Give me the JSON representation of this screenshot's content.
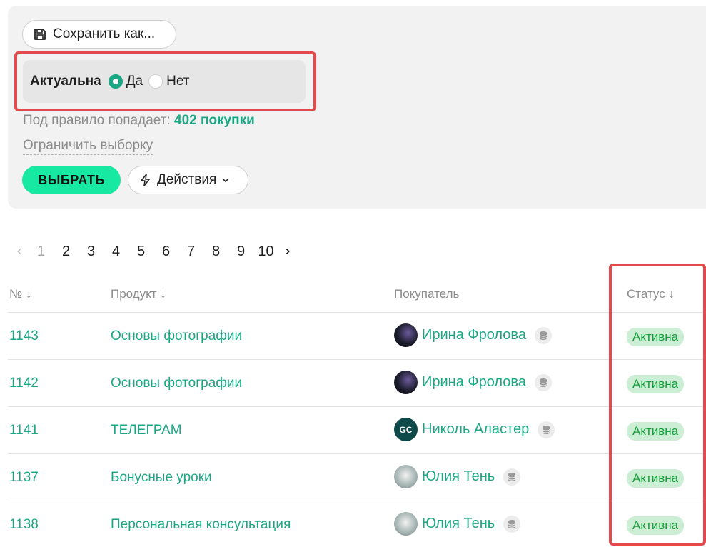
{
  "toolbar": {
    "save_as_label": "Сохранить как..."
  },
  "filter": {
    "title": "Актуальна",
    "options": [
      {
        "label": "Да",
        "checked": true
      },
      {
        "label": "Нет",
        "checked": false
      }
    ],
    "rule_text": "Под правило попадает:",
    "rule_count": "402 покупки",
    "limit_link": "Ограничить выборку",
    "select_label": "ВЫБРАТЬ",
    "actions_label": "Действия"
  },
  "pagination": {
    "current": "1",
    "pages": [
      "1",
      "2",
      "3",
      "4",
      "5",
      "6",
      "7",
      "8",
      "9",
      "10"
    ]
  },
  "table": {
    "headers": {
      "num": "№ ↓",
      "product": "Продукт ↓",
      "buyer": "Покупатель",
      "status": "Статус ↓"
    },
    "rows": [
      {
        "num": "1143",
        "product": "Основы фотографии",
        "buyer": "Ирина Фролова",
        "avatar": "dark",
        "status": "Активна"
      },
      {
        "num": "1142",
        "product": "Основы фотографии",
        "buyer": "Ирина Фролова",
        "avatar": "dark",
        "status": "Активна"
      },
      {
        "num": "1141",
        "product": "ТЕЛЕГРАМ",
        "buyer": "Николь Аластер",
        "avatar": "gc",
        "avatar_text": "GC",
        "status": "Активна"
      },
      {
        "num": "1137",
        "product": "Бонусные уроки",
        "buyer": "Юлия Тень",
        "avatar": "light",
        "status": "Активна"
      },
      {
        "num": "1138",
        "product": "Персональная консультация",
        "buyer": "Юлия Тень",
        "avatar": "light",
        "status": "Активна"
      }
    ]
  },
  "colors": {
    "accent": "#1ba784",
    "select_button": "#17e8a2",
    "highlight": "#e5484d",
    "status_bg": "#cbeed5",
    "status_text": "#1a9c3b"
  },
  "icons": {
    "save": "floppy-disk-icon",
    "actions": "lightning-icon",
    "dropdown": "chevron-down-icon",
    "database": "database-icon",
    "prev": "chevron-left-icon",
    "next": "chevron-right-icon"
  }
}
